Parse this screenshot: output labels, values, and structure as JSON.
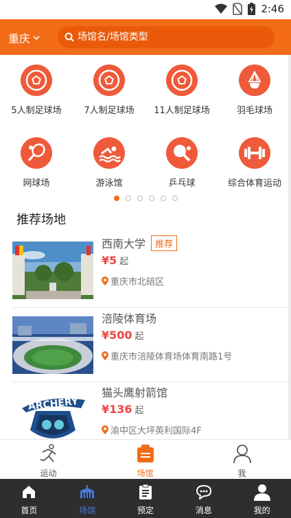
{
  "status": {
    "time": "2:46"
  },
  "header": {
    "city": "重庆",
    "search_placeholder": "场馆名/场馆类型"
  },
  "categories": [
    {
      "label": "5人制足球场",
      "icon": "soccer-ball-icon"
    },
    {
      "label": "7人制足球场",
      "icon": "soccer-ball-icon"
    },
    {
      "label": "11人制足球场",
      "icon": "soccer-ball-icon"
    },
    {
      "label": "羽毛球场",
      "icon": "shuttlecock-icon"
    },
    {
      "label": "网球场",
      "icon": "tennis-racket-icon"
    },
    {
      "label": "游泳馆",
      "icon": "swimmer-icon"
    },
    {
      "label": "乒乓球",
      "icon": "ping-pong-icon"
    },
    {
      "label": "综合体育运动",
      "icon": "dumbbell-icon"
    }
  ],
  "pager": {
    "count": 6,
    "active": 0
  },
  "section_title": "推荐场地",
  "venues": [
    {
      "name": "西南大学",
      "badge": "推荐",
      "price": "¥5",
      "unit": "起",
      "address": "重庆市北碚区"
    },
    {
      "name": "涪陵体育场",
      "badge": "",
      "price": "¥500",
      "unit": "起",
      "address": "重庆市涪陵体育场体育南路1号"
    },
    {
      "name": "猫头鹰射箭馆",
      "badge": "",
      "price": "¥136",
      "unit": "起",
      "address": "渝中区大坪英利国际4F",
      "logo_text": "ARCHERY"
    }
  ],
  "inner_tabs": [
    {
      "label": "运动",
      "icon": "runner-icon",
      "active": false
    },
    {
      "label": "场馆",
      "icon": "venue-icon",
      "active": true
    },
    {
      "label": "我",
      "icon": "user-icon",
      "active": false
    }
  ],
  "bottom_nav": [
    {
      "label": "首页",
      "icon": "home-icon",
      "active": false
    },
    {
      "label": "场馆",
      "icon": "stadium-icon",
      "active": true
    },
    {
      "label": "预定",
      "icon": "clipboard-icon",
      "active": false
    },
    {
      "label": "消息",
      "icon": "chat-icon",
      "active": false
    },
    {
      "label": "我的",
      "icon": "profile-icon",
      "active": false
    }
  ],
  "colors": {
    "accent": "#f26b17",
    "category_icon": "#ef5a3a",
    "price": "#e44444",
    "nav_active": "#4a78d8",
    "nav_bg": "#2e2e2e"
  }
}
